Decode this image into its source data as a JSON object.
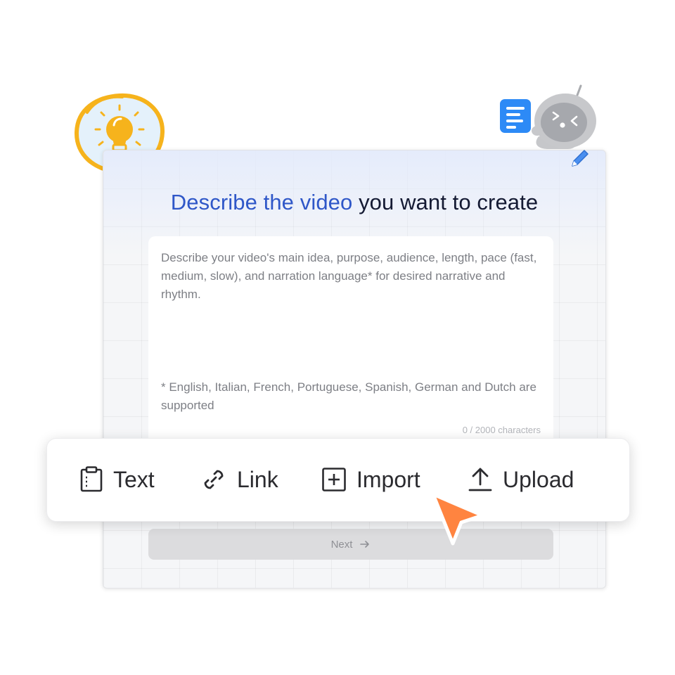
{
  "heading": {
    "accent": "Describe the video",
    "rest": " you want to create"
  },
  "prompt": {
    "placeholder": "Describe your video's main idea, purpose, audience, length, pace (fast, medium, slow), and narration language* for desired narrative and rhythm.",
    "note": "* English, Italian, French, Portuguese, Spanish, German and Dutch are supported",
    "counter": "0 / 2000 characters"
  },
  "next_button": {
    "label": "Next"
  },
  "toolbar": {
    "items": [
      {
        "label": "Text",
        "icon": "clipboard-icon"
      },
      {
        "label": "Link",
        "icon": "link-icon"
      },
      {
        "label": "Import",
        "icon": "plus-square-icon"
      },
      {
        "label": "Upload",
        "icon": "upload-icon"
      }
    ]
  },
  "decorations": {
    "lightbulb": "lightbulb-icon",
    "robot": "robot-mascot",
    "document": "document-icon",
    "pencil": "pencil-icon",
    "cursor": "cursor-pointer-icon"
  },
  "colors": {
    "accent_blue": "#2f57c8",
    "title_dark": "#141a33",
    "bulb_yellow": "#f6b31c",
    "bulb_bg": "#e4f1fb",
    "doc_blue": "#2d8af6",
    "cursor_orange": "#ff8440",
    "button_gray": "#dcdcde"
  }
}
